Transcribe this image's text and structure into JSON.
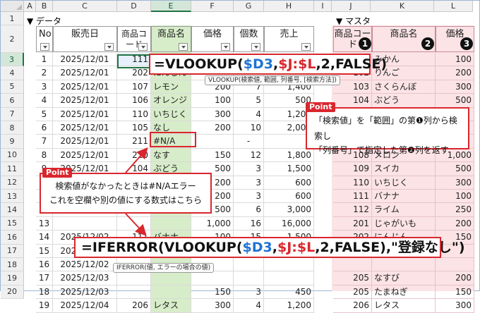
{
  "columns": [
    "A",
    "B",
    "C",
    "D",
    "E",
    "F",
    "G",
    "H",
    "I",
    "J",
    "K",
    "L"
  ],
  "rows": [
    "1",
    "2",
    "3",
    "4",
    "5",
    "6",
    "7",
    "8",
    "9",
    "10",
    "11",
    "12",
    "13",
    "14",
    "15",
    "16",
    "17",
    "18",
    "19",
    "20"
  ],
  "section_data": "▼ データ",
  "section_master": "▼ マスタ",
  "data_headers": {
    "no": "No",
    "date": "販売日",
    "code": "商品コード",
    "name": "商品名",
    "price": "価格",
    "qty": "個数",
    "sales": "売上"
  },
  "master_headers": {
    "code": "商品コード",
    "name": "商品名",
    "price": "価格"
  },
  "data_rows": [
    {
      "no": "1",
      "date": "2025/12/01",
      "code": "111",
      "name": "",
      "price": "",
      "qty": "",
      "sales": ""
    },
    {
      "no": "2",
      "date": "2025/12/01",
      "code": "202",
      "name": "にんじん",
      "price": "",
      "qty": "",
      "sales": ""
    },
    {
      "no": "3",
      "date": "2025/12/01",
      "code": "107",
      "name": "レモン",
      "price": "200",
      "qty": "7",
      "sales": "1,400"
    },
    {
      "no": "4",
      "date": "2025/12/01",
      "code": "106",
      "name": "オレンジ",
      "price": "100",
      "qty": "5",
      "sales": "500"
    },
    {
      "no": "5",
      "date": "2025/12/01",
      "code": "110",
      "name": "いちじく",
      "price": "300",
      "qty": "4",
      "sales": "1,200"
    },
    {
      "no": "6",
      "date": "2025/12/01",
      "code": "105",
      "name": "なし",
      "price": "200",
      "qty": "10",
      "sales": "2,000"
    },
    {
      "no": "7",
      "date": "2025/12/01",
      "code": "211",
      "name": "#N/A",
      "price": "",
      "qty": "-",
      "sales": ""
    },
    {
      "no": "8",
      "date": "2025/12/01",
      "code": "210",
      "name": "なす",
      "price": "150",
      "qty": "12",
      "sales": "1,800"
    },
    {
      "no": "9",
      "date": "2025/12/01",
      "code": "104",
      "name": "ぶどう",
      "price": "500",
      "qty": "3",
      "sales": "1,500"
    },
    {
      "no": "10",
      "date": "",
      "code": "",
      "name": "",
      "price": "200",
      "qty": "3",
      "sales": "600"
    },
    {
      "no": "11",
      "date": "",
      "code": "",
      "name": "",
      "price": "200",
      "qty": "3",
      "sales": "600"
    },
    {
      "no": "12",
      "date": "",
      "code": "",
      "name": "",
      "price": "500",
      "qty": "6",
      "sales": "3,000"
    },
    {
      "no": "13",
      "date": "",
      "code": "",
      "name": "",
      "price": "1,000",
      "qty": "16",
      "sales": "16,000"
    },
    {
      "no": "14",
      "date": "2025/12/02",
      "code": "111",
      "name": "バナナ",
      "price": "100",
      "qty": "15",
      "sales": "1,500"
    },
    {
      "no": "15",
      "date": "2025/12/02",
      "code": "107",
      "name": "レモン",
      "price": "200",
      "qty": "10",
      "sales": "2,000"
    },
    {
      "no": "16",
      "date": "2025/12/02",
      "code": "",
      "name": "",
      "price": "",
      "qty": "",
      "sales": ""
    },
    {
      "no": "17",
      "date": "2025/12/03",
      "code": "",
      "name": "",
      "price": "",
      "qty": "",
      "sales": ""
    },
    {
      "no": "18",
      "date": "2025/12/03",
      "code": "",
      "name": "",
      "price": "150",
      "qty": "3",
      "sales": "450"
    },
    {
      "no": "19",
      "date": "2025/12/04",
      "code": "206",
      "name": "レタス",
      "price": "300",
      "qty": "4",
      "sales": "1,200"
    }
  ],
  "master_rows": [
    {
      "code": "",
      "name": "みかん",
      "price": "100"
    },
    {
      "code": "102",
      "name": "りんご",
      "price": "200"
    },
    {
      "code": "103",
      "name": "さくらんぼ",
      "price": "300"
    },
    {
      "code": "104",
      "name": "ぶどう",
      "price": "500"
    },
    {
      "code": "",
      "name": "",
      "price": ""
    },
    {
      "code": "",
      "name": "",
      "price": ""
    },
    {
      "code": "",
      "name": "",
      "price": ""
    },
    {
      "code": "108",
      "name": "メロン",
      "price": "1,000"
    },
    {
      "code": "109",
      "name": "スイカ",
      "price": "500"
    },
    {
      "code": "110",
      "name": "いちじく",
      "price": "300"
    },
    {
      "code": "111",
      "name": "バナナ",
      "price": "100"
    },
    {
      "code": "112",
      "name": "ライム",
      "price": "250"
    },
    {
      "code": "201",
      "name": "じゃがいも",
      "price": "200"
    },
    {
      "code": "202",
      "name": "にんじん",
      "price": "150"
    },
    {
      "code": "",
      "name": "",
      "price": ""
    },
    {
      "code": "",
      "name": "",
      "price": ""
    },
    {
      "code": "205",
      "name": "なすび",
      "price": "200"
    },
    {
      "code": "205",
      "name": "たまねぎ",
      "price": "150"
    },
    {
      "code": "206",
      "name": "レタス",
      "price": "300"
    }
  ],
  "formula1": {
    "a": "=VLOOKUP(",
    "b": "$D3",
    ",": ",",
    "c": "$J:$L",
    ",2": ",2,FALSE)"
  },
  "tooltip1": "VLOOKUP(検索値, 範囲, 列番号, [検索方法])",
  "formula2": {
    "a": "=IFERROR(VLOOKUP(",
    "b": "$D3",
    ",": ",",
    "c": "$J:$L",
    ",2": ",2,FALSE),\"登録なし\")"
  },
  "tooltip2": "IFERROR(値, エラーの場合の値)",
  "point_label": "Point",
  "callout_right": {
    "line1": "「検索値」を「範囲」の第❶列から検索し",
    "line2": "「列番号」で指定した第❷列を返す"
  },
  "callout_left": {
    "line1": "検索値がなかったときは#N/Aエラー",
    "line2": "これを空欄や別の値にする数式はこちら"
  },
  "circle_1": "1",
  "circle_2": "2",
  "circle_3": "3",
  "colors": {
    "accent_red": "#d9272e",
    "formula_blue": "#1f73d3",
    "green_band": "#d7ecc9",
    "pink_band": "#fbe3e6"
  }
}
